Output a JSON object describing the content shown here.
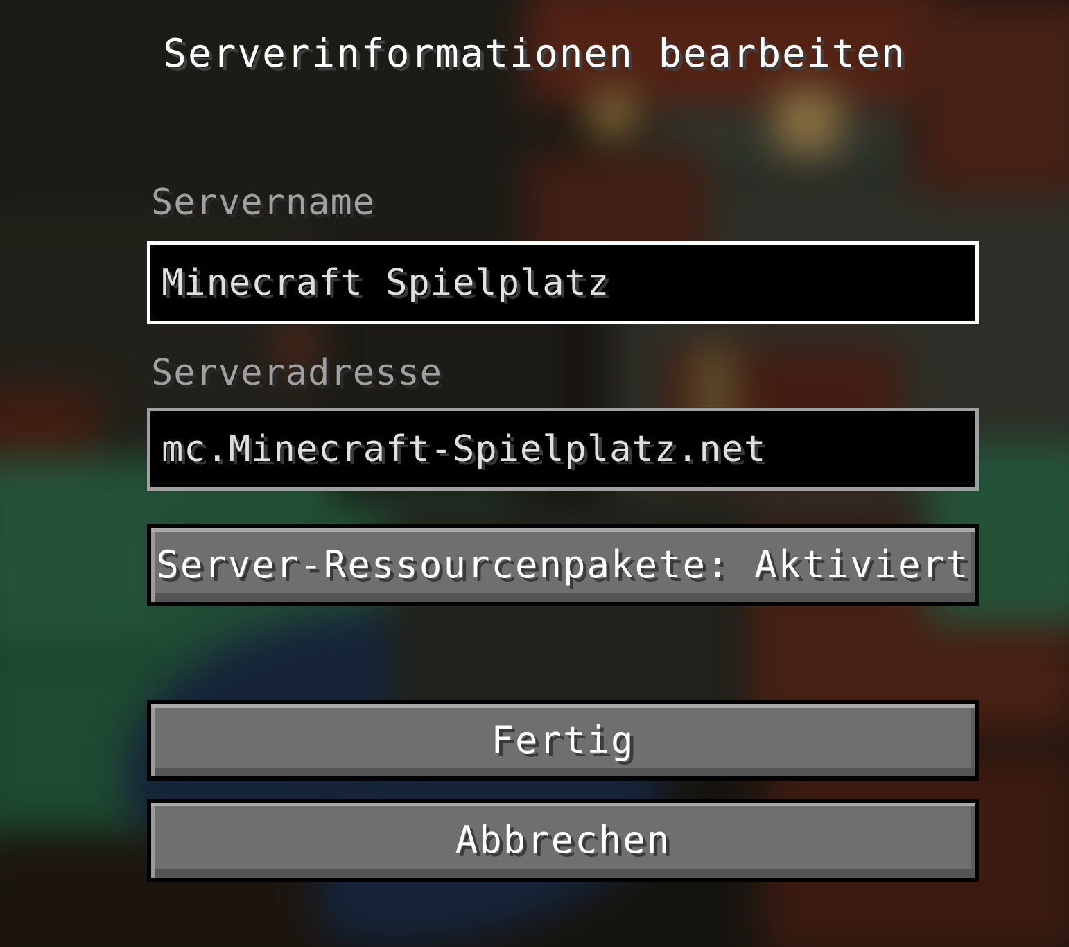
{
  "screen": {
    "title": "Serverinformationen bearbeiten"
  },
  "server_name": {
    "label": "Servername",
    "value": "Minecraft Spielplatz"
  },
  "server_address": {
    "label": "Serveradresse",
    "value": "mc.Minecraft-Spielplatz.net"
  },
  "buttons": {
    "resource_packs": "Server-Ressourcenpakete: Aktiviert",
    "done": "Fertig",
    "cancel": "Abbrechen"
  },
  "colors": {
    "title_text": "#ffffff",
    "label_text": "#a0a0a0",
    "field_background": "#000000",
    "focused_border": "#ffffff",
    "unfocused_border": "#a0a0a0",
    "button_face": "#6f6f6f"
  }
}
